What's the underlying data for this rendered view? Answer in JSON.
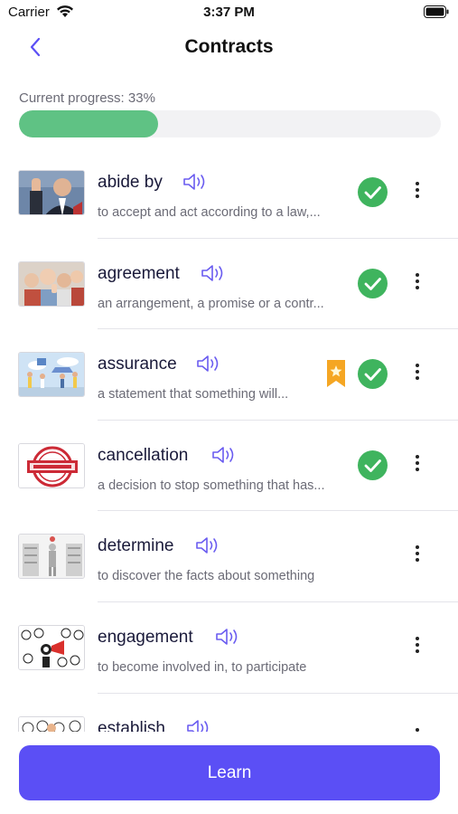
{
  "status_bar": {
    "carrier": "Carrier",
    "time": "3:37 PM"
  },
  "nav": {
    "title": "Contracts"
  },
  "progress": {
    "label": "Current progress: 33%",
    "fraction": 0.33,
    "color": "#5fc284"
  },
  "words": [
    {
      "word": "abide by",
      "definition": "to accept and act according to a law,...",
      "learned": true,
      "bookmarked": false,
      "image": "man-raising-hand-photo"
    },
    {
      "word": "agreement",
      "definition": "an arrangement, a promise or a contr...",
      "learned": true,
      "bookmarked": false,
      "image": "group-thumbs-up-photo"
    },
    {
      "word": "assurance",
      "definition": "a statement that something will...",
      "learned": true,
      "bookmarked": true,
      "image": "family-car-illustration"
    },
    {
      "word": "cancellation",
      "definition": "a decision to stop something that has...",
      "learned": true,
      "bookmarked": false,
      "image": "cancelled-stamp"
    },
    {
      "word": "determine",
      "definition": "to discover the facts about something",
      "learned": false,
      "bookmarked": false,
      "image": "person-among-cabinets-illustration"
    },
    {
      "word": "engagement",
      "definition": "to become involved in, to participate",
      "learned": false,
      "bookmarked": false,
      "image": "crowd-megaphone-sketch"
    },
    {
      "word": "establish",
      "definition": "",
      "learned": false,
      "bookmarked": false,
      "image": "sketch-faces"
    }
  ],
  "learn_button": {
    "label": "Learn"
  },
  "colors": {
    "accent": "#5b4ff5",
    "check": "#3fb45e",
    "bookmark": "#f5a623"
  }
}
